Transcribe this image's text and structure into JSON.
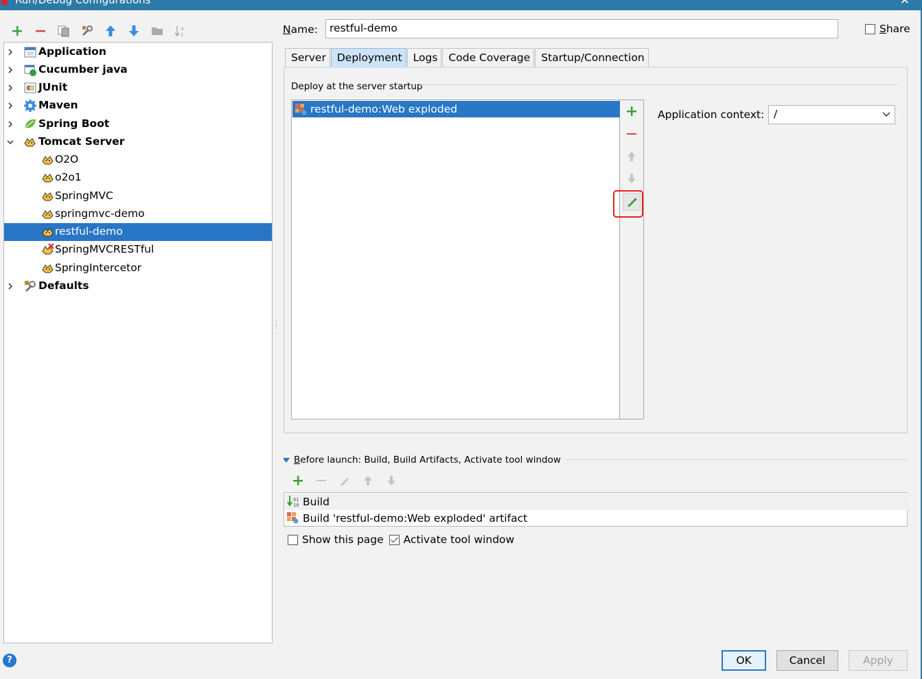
{
  "window": {
    "title": "Run/Debug Configurations",
    "close_glyph": "✕"
  },
  "left_toolbar": {
    "buttons": [
      "add-icon",
      "remove-icon",
      "copy-icon",
      "wrench-icon",
      "move-up-icon",
      "move-down-icon",
      "folder-icon",
      "sort-icon"
    ]
  },
  "tree": {
    "items": [
      {
        "label": "Application",
        "bold": true,
        "expandable": true,
        "expanded": false,
        "icon": "application-icon"
      },
      {
        "label": "Cucumber java",
        "bold": true,
        "expandable": true,
        "expanded": false,
        "icon": "cucumber-icon"
      },
      {
        "label": "JUnit",
        "bold": true,
        "expandable": true,
        "expanded": false,
        "icon": "junit-icon"
      },
      {
        "label": "Maven",
        "bold": true,
        "expandable": true,
        "expanded": false,
        "icon": "maven-icon"
      },
      {
        "label": "Spring Boot",
        "bold": true,
        "expandable": true,
        "expanded": false,
        "icon": "spring-boot-icon"
      },
      {
        "label": "Tomcat Server",
        "bold": true,
        "expandable": true,
        "expanded": true,
        "icon": "tomcat-icon"
      },
      {
        "label": "O2O",
        "bold": false,
        "icon": "tomcat-icon"
      },
      {
        "label": "o2o1",
        "bold": false,
        "icon": "tomcat-icon"
      },
      {
        "label": "SpringMVC",
        "bold": false,
        "icon": "tomcat-icon"
      },
      {
        "label": "springmvc-demo",
        "bold": false,
        "icon": "tomcat-icon"
      },
      {
        "label": "restful-demo",
        "bold": false,
        "selected": true,
        "icon": "tomcat-icon"
      },
      {
        "label": "SpringMVCRESTful",
        "bold": false,
        "icon": "tomcat-error-icon"
      },
      {
        "label": "SpringIntercetor",
        "bold": false,
        "icon": "tomcat-icon"
      },
      {
        "label": "Defaults",
        "bold": true,
        "expandable": true,
        "expanded": false,
        "icon": "defaults-icon"
      }
    ]
  },
  "form": {
    "name_label_prefix": "N",
    "name_label_rest": "ame:",
    "name_value": "restful-demo",
    "share_label_prefix": "S",
    "share_label_rest": "hare",
    "share_checked": false
  },
  "tabs": [
    {
      "label": "Server",
      "active": false
    },
    {
      "label": "Deployment",
      "active": true
    },
    {
      "label": "Logs",
      "active": false
    },
    {
      "label": "Code Coverage",
      "active": false
    },
    {
      "label": "Startup/Connection",
      "active": false
    }
  ],
  "deployment": {
    "header": "Deploy at the server startup",
    "artifacts": [
      {
        "label": "restful-demo:Web exploded",
        "selected": true
      }
    ],
    "side_buttons": [
      "add-icon",
      "remove-icon",
      "move-up-icon",
      "move-down-icon",
      "edit-pencil-icon"
    ],
    "highlighted_button": "edit-pencil-icon",
    "context_label": "Application context:",
    "context_value": "/"
  },
  "before_launch": {
    "header_prefix": "B",
    "header_rest": "efore launch: Build, Build Artifacts, Activate tool window",
    "toolbar": [
      "add-icon",
      "remove-icon",
      "edit-icon",
      "move-up-icon",
      "move-down-icon"
    ],
    "tasks": [
      {
        "label": "Build",
        "icon": "build-icon"
      },
      {
        "label": "Build 'restful-demo:Web exploded' artifact",
        "icon": "artifact-icon"
      }
    ],
    "show_this_page_label": "Show this page",
    "show_this_page_checked": false,
    "activate_tool_window_label": "Activate tool window",
    "activate_tool_window_checked": true
  },
  "buttons": {
    "ok": "OK",
    "cancel": "Cancel",
    "apply": "Apply",
    "help": "?"
  },
  "colors": {
    "selection": "#2876c5",
    "title_bar": "#2b7aa8",
    "highlight_box": "#e8201e",
    "add_green": "#3aa03a",
    "remove_red": "#d9443e"
  }
}
